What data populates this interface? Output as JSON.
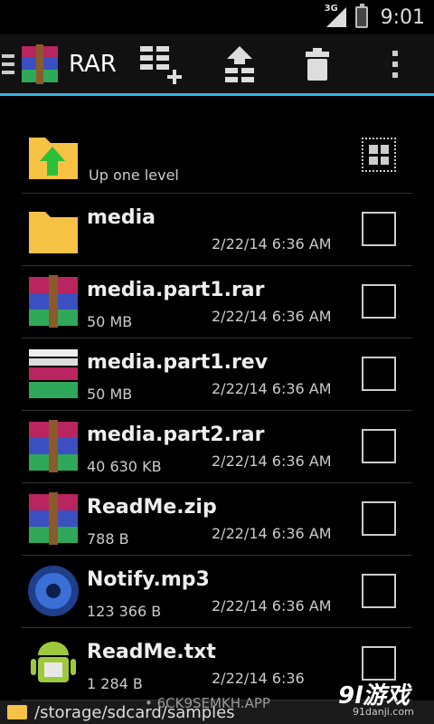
{
  "status": {
    "network": "3G",
    "time": "9:01"
  },
  "app": {
    "title": "RAR"
  },
  "toolbar": {
    "add": "add-to-archive-icon",
    "extract": "extract-icon",
    "delete": "trash-icon",
    "more": "overflow-menu-icon"
  },
  "list": {
    "up_label": "Up one level",
    "files": [
      {
        "name": "media",
        "size": "",
        "date": "2/22/14 6:36 AM",
        "type": "folder"
      },
      {
        "name": "media.part1.rar",
        "size": "50 MB",
        "date": "2/22/14 6:36 AM",
        "type": "rar"
      },
      {
        "name": "media.part1.rev",
        "size": "50 MB",
        "date": "2/22/14 6:36 AM",
        "type": "rev"
      },
      {
        "name": "media.part2.rar",
        "size": "40 630 KB",
        "date": "2/22/14 6:36 AM",
        "type": "rar"
      },
      {
        "name": "ReadMe.zip",
        "size": "788 B",
        "date": "2/22/14 6:36 AM",
        "type": "zip"
      },
      {
        "name": "Notify.mp3",
        "size": "123 366 B",
        "date": "2/22/14 6:36 AM",
        "type": "audio"
      },
      {
        "name": "ReadMe.txt",
        "size": "1 284 B",
        "date": "2/22/14 6:36",
        "type": "text"
      }
    ]
  },
  "path_bar": {
    "path": "/storage/sdcard/samples"
  },
  "watermark": {
    "code": "• 6CK9SEMKH.APP",
    "logo": "9l游戏",
    "site": "91danji.com"
  },
  "colors": {
    "accent": "#33b5e5",
    "folder": "#f6c244"
  }
}
